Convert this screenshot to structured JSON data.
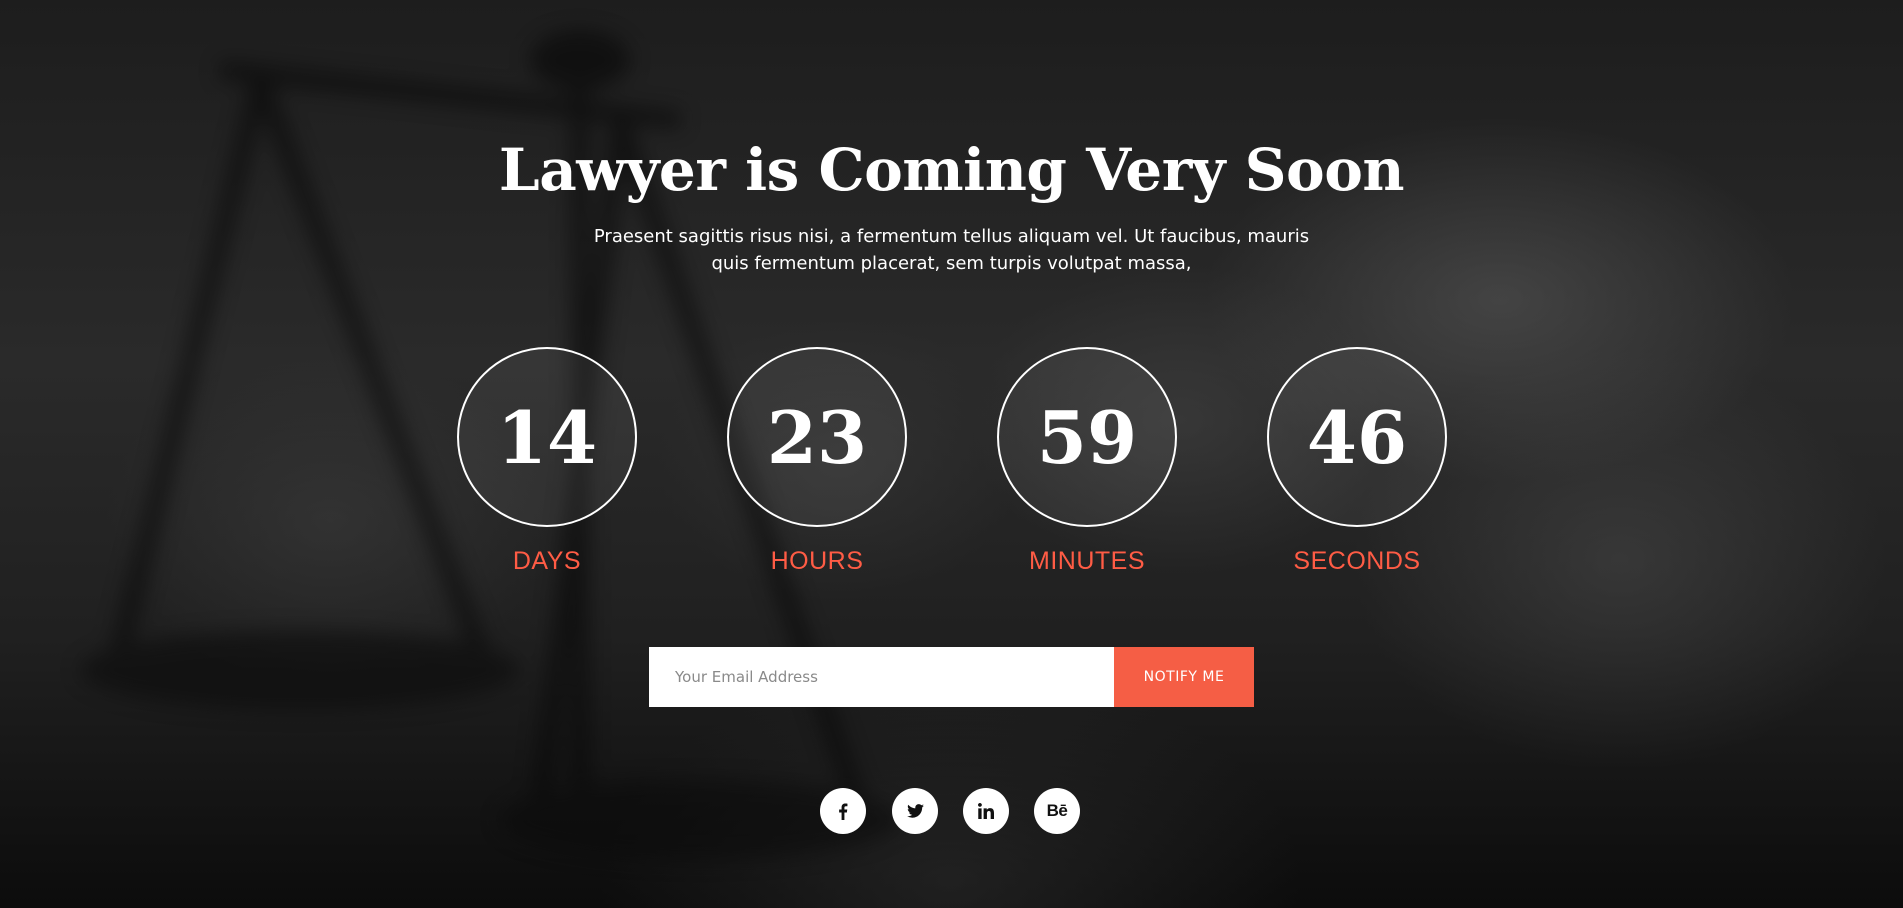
{
  "hero": {
    "title": "Lawyer is Coming Very Soon",
    "subtitle_line1": "Praesent sagittis risus nisi, a fermentum tellus aliquam vel. Ut faucibus, mauris",
    "subtitle_line2": "quis fermentum placerat, sem turpis volutpat massa,"
  },
  "countdown": {
    "days": {
      "value": "14",
      "label": "DAYS"
    },
    "hours": {
      "value": "23",
      "label": "HOURS"
    },
    "minutes": {
      "value": "59",
      "label": "MINUTES"
    },
    "seconds": {
      "value": "46",
      "label": "SECONDS"
    }
  },
  "subscribe": {
    "email_placeholder": "Your Email Address",
    "email_value": "",
    "button_label": "NOTIFY ME"
  },
  "social": {
    "items": [
      {
        "icon": "facebook-icon"
      },
      {
        "icon": "twitter-icon"
      },
      {
        "icon": "linkedin-icon"
      },
      {
        "icon": "behance-icon",
        "glyph": "Bē"
      }
    ]
  },
  "colors": {
    "accent": "#f55e45",
    "label": "#ff5c45",
    "text": "#ffffff"
  }
}
